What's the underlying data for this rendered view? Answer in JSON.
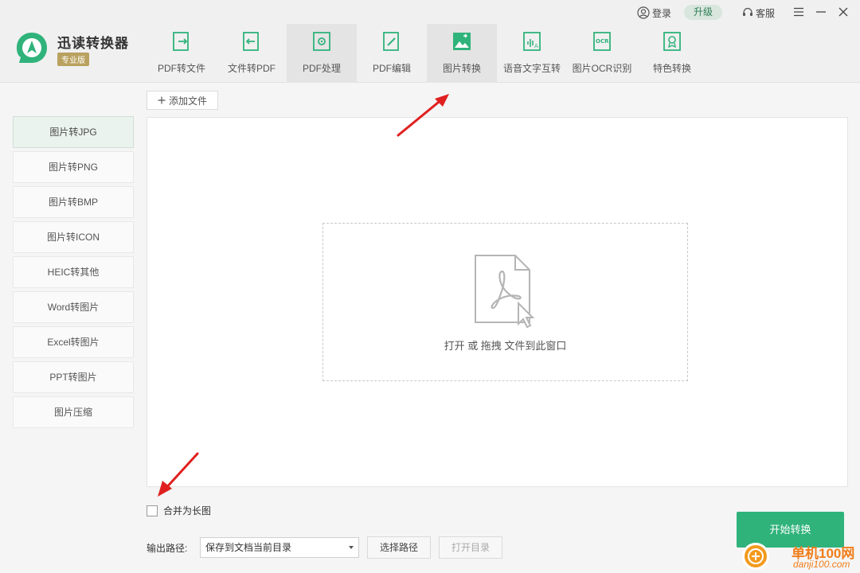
{
  "app": {
    "title": "迅读转换器",
    "edition": "专业版"
  },
  "topbar": {
    "login": "登录",
    "upgrade": "升级",
    "service": "客服"
  },
  "tabs": [
    {
      "label": "PDF转文件",
      "icon": "pdf-export-icon"
    },
    {
      "label": "文件转PDF",
      "icon": "pdf-import-icon"
    },
    {
      "label": "PDF处理",
      "icon": "pdf-process-icon"
    },
    {
      "label": "PDF编辑",
      "icon": "pdf-edit-icon"
    },
    {
      "label": "图片转换",
      "icon": "image-convert-icon"
    },
    {
      "label": "语音文字互转",
      "icon": "voice-text-icon"
    },
    {
      "label": "图片OCR识别",
      "icon": "ocr-icon"
    },
    {
      "label": "特色转换",
      "icon": "special-convert-icon"
    }
  ],
  "sidebar": {
    "items": [
      {
        "label": "图片转JPG"
      },
      {
        "label": "图片转PNG"
      },
      {
        "label": "图片转BMP"
      },
      {
        "label": "图片转ICON"
      },
      {
        "label": "HEIC转其他"
      },
      {
        "label": "Word转图片"
      },
      {
        "label": "Excel转图片"
      },
      {
        "label": "PPT转图片"
      },
      {
        "label": "图片压缩"
      }
    ]
  },
  "main": {
    "add_file": "添加文件",
    "drop_hint": "打开 或 拖拽 文件到此窗口",
    "merge_label": "合并为长图",
    "output_label": "输出路径:",
    "output_value": "保存到文档当前目录",
    "choose_path": "选择路径",
    "open_dir": "打开目录",
    "start": "开始转换"
  },
  "watermark": {
    "line1": "单机100网",
    "line2": "danji100.com"
  },
  "colors": {
    "accent": "#2fb37b",
    "annotation": "#e02020"
  }
}
